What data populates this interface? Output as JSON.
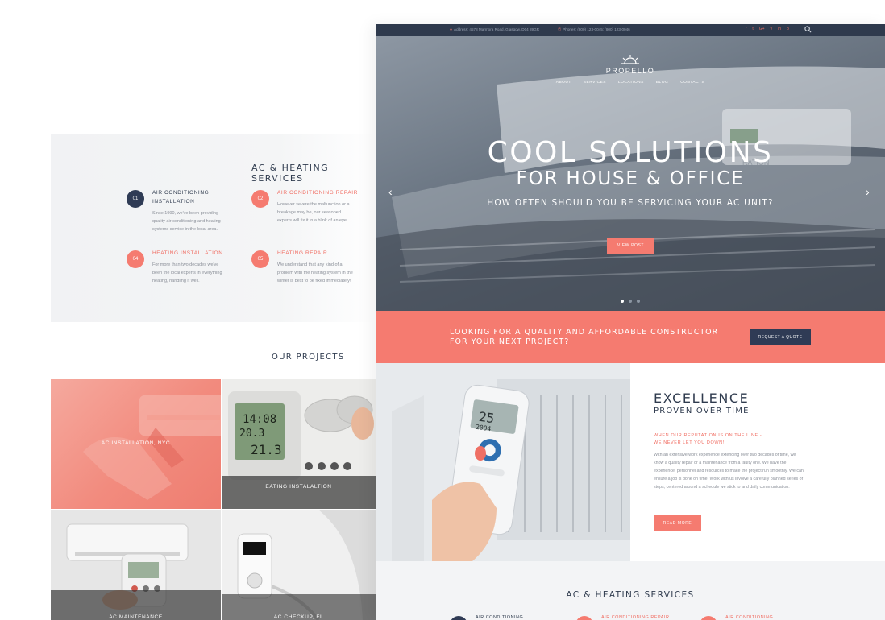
{
  "left": {
    "services_title": "AC & HEATING SERVICES",
    "items": [
      {
        "num": "01",
        "title": "AIR CONDITIONING INSTALLATION",
        "text": "Since 1990, we've been providing quality air conditioning and heating systems service in the local area."
      },
      {
        "num": "02",
        "title": "AIR CONDITIONING REPAIR",
        "text": "However severe the malfunction or a breakage may be, our seasoned experts will fix it in a blink of an eye!"
      },
      {
        "num": "04",
        "title": "HEATING INSTALLATION",
        "text": "For more than two decades we've been the local experts in everything heating, handling it well."
      },
      {
        "num": "05",
        "title": "HEATING REPAIR",
        "text": "We understand that any kind of a problem with the heating system in the winter is best to be fixed immediately!"
      }
    ],
    "projects_title": "OUR PROJECTS",
    "projects": [
      {
        "label": "AC INSTALLATION, NYC"
      },
      {
        "label": "EATING INSTALALTION"
      },
      {
        "label": "AC MAINTENANCE"
      },
      {
        "label": "AC CHECKUP, FL"
      }
    ],
    "thermostat_digits": {
      "time": "14:08",
      "temp1": "20.3",
      "temp2": "21.3"
    }
  },
  "right": {
    "topbar": {
      "address": "Address: 4578 Marmora Road, Glasgow, D04 89GR",
      "phone": "Phones: (800) 123-0045; (800) 123-0046",
      "social": [
        "f",
        "t",
        "G+",
        "v",
        "in",
        "p"
      ]
    },
    "logo": "PROPELLO",
    "nav": [
      "ABOUT",
      "SERVICES",
      "LOCATIONS",
      "BLOG",
      "CONTACTS"
    ],
    "hero": {
      "title": "COOL SOLUTIONS",
      "subtitle": "FOR HOUSE & OFFICE",
      "question": "HOW OFTEN SHOULD YOU BE SERVICING YOUR AC UNIT?",
      "button": "VIEW POST",
      "unit_label": "RATION"
    },
    "cta": {
      "line1": "LOOKING FOR A QUALITY AND AFFORDABLE CONSTRUCTOR",
      "line2": "FOR YOUR NEXT PROJECT?",
      "button": "REQUEST A QUOTE"
    },
    "excellence": {
      "title": "EXCELLENCE",
      "subtitle": "PROVEN OVER TIME",
      "tag1": "WHEN OUR REPUTATION IS ON THE LINE -",
      "tag2": "WE NEVER LET YOU DOWN!",
      "body": "With an extensive work experience extending over two decades of time, we know a quality repair or a maintenance from a faulty one. We have the experience, personnel and resources to make the project run smoothly. We can ensure a job is done on time. Work with us involve a carefully planned series of steps, centered around a schedule we stick to and daily communication.",
      "button": "READ MORE",
      "remote_digits": {
        "top": "25",
        "bottom": "2004"
      }
    },
    "bottom": {
      "title": "AC & HEATING SERVICES",
      "peek1": "AIR CONDITIONING",
      "peek2": "AIR CONDITIONING REPAIR",
      "peek3": "AIR CONDITIONING"
    }
  },
  "colors": {
    "accent": "#f57b70",
    "navy": "#2f3b55",
    "text": "#2f3b4e"
  }
}
